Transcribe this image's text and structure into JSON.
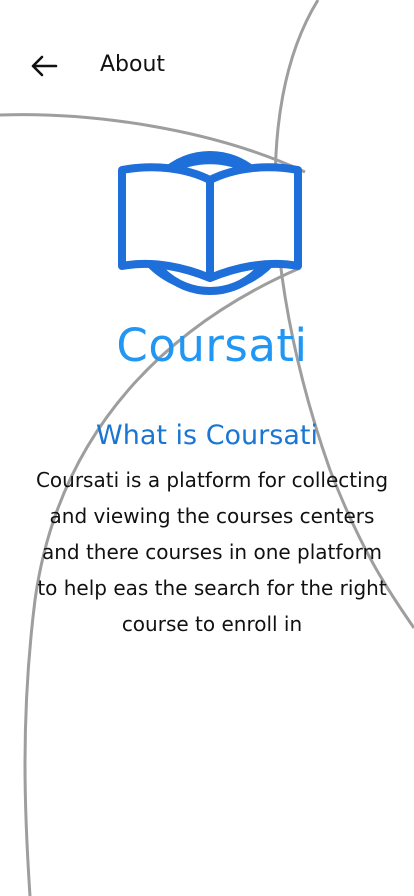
{
  "header": {
    "back_icon": "arrow-left-icon",
    "title": "About"
  },
  "brand": {
    "logo_icon": "open-book-circle-icon",
    "name": "Coursati",
    "accent_color": "#2196f3"
  },
  "about": {
    "heading": "What is Coursati",
    "description": "Coursati is  a platform for collecting\n and viewing the courses centers\nand there courses in one platform\nto help eas the search for the right\ncourse to enroll in"
  }
}
